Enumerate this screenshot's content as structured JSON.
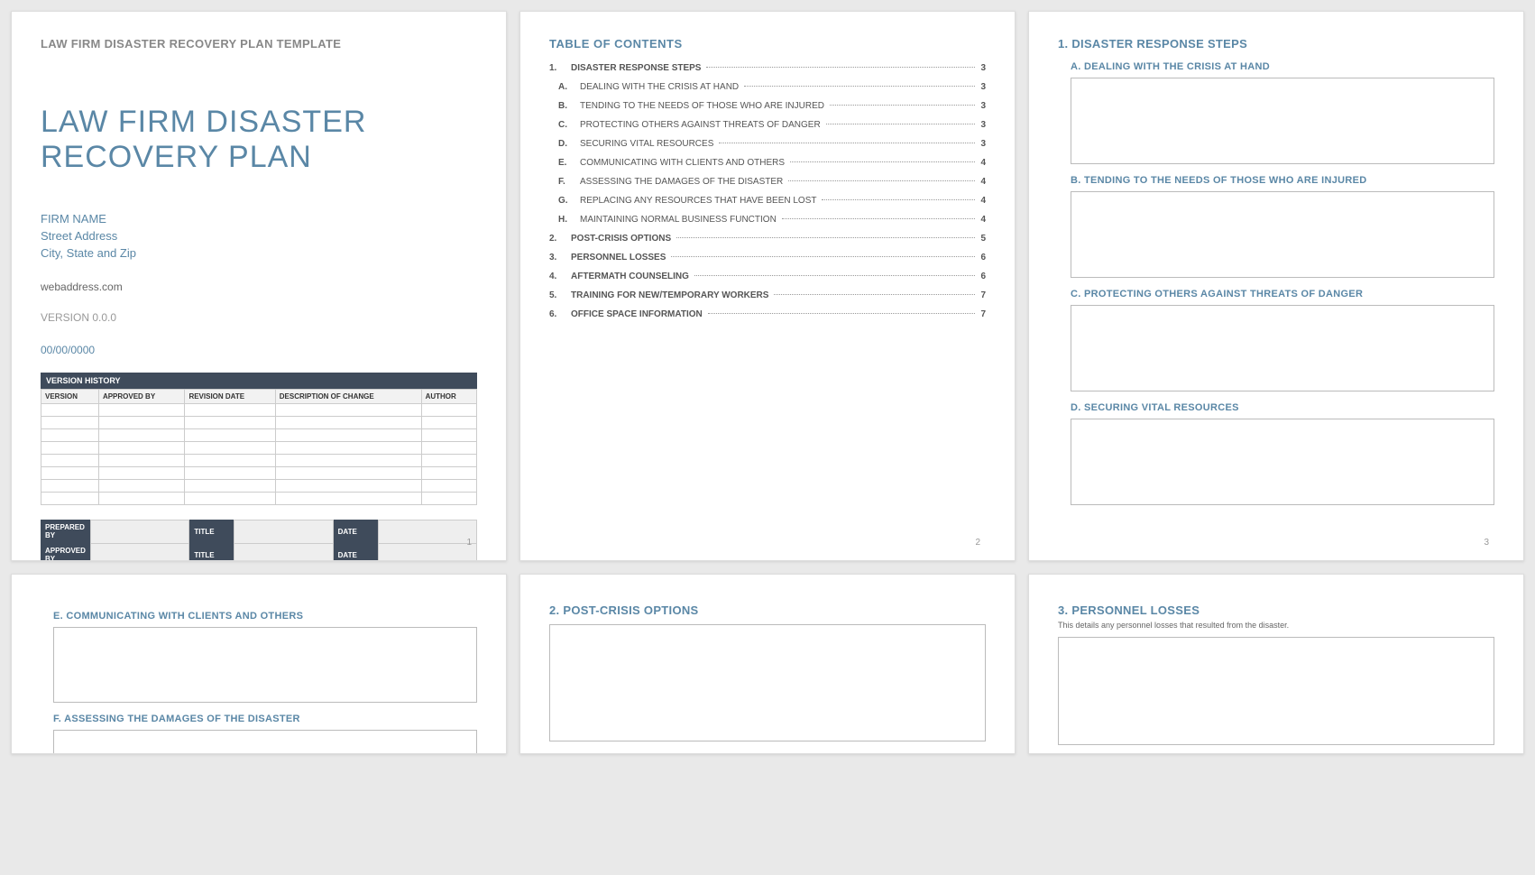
{
  "page1": {
    "template_title": "LAW FIRM DISASTER RECOVERY PLAN TEMPLATE",
    "main_title": "LAW FIRM DISASTER RECOVERY PLAN",
    "firm_name": "FIRM NAME",
    "street": "Street Address",
    "city": "City, State and Zip",
    "web": "webaddress.com",
    "version": "VERSION 0.0.0",
    "date": "00/00/0000",
    "vh_title": "VERSION HISTORY",
    "cols": {
      "c1": "VERSION",
      "c2": "APPROVED BY",
      "c3": "REVISION DATE",
      "c4": "DESCRIPTION OF CHANGE",
      "c5": "AUTHOR"
    },
    "sig": {
      "r1": "PREPARED BY",
      "r2": "APPROVED BY",
      "title": "TITLE",
      "date": "DATE"
    },
    "pnum": "1"
  },
  "page2": {
    "title": "TABLE OF CONTENTS",
    "items": [
      {
        "n": "1.",
        "t": "DISASTER RESPONSE STEPS",
        "p": "3",
        "b": true
      },
      {
        "n": "A.",
        "t": "DEALING WITH THE CRISIS AT HAND",
        "p": "3"
      },
      {
        "n": "B.",
        "t": "TENDING TO THE NEEDS OF THOSE WHO ARE INJURED",
        "p": "3"
      },
      {
        "n": "C.",
        "t": "PROTECTING OTHERS AGAINST THREATS OF DANGER",
        "p": "3"
      },
      {
        "n": "D.",
        "t": "SECURING VITAL RESOURCES",
        "p": "3"
      },
      {
        "n": "E.",
        "t": "COMMUNICATING WITH CLIENTS AND OTHERS",
        "p": "4"
      },
      {
        "n": "F.",
        "t": "ASSESSING THE DAMAGES OF THE DISASTER",
        "p": "4"
      },
      {
        "n": "G.",
        "t": "REPLACING ANY RESOURCES THAT HAVE BEEN LOST",
        "p": "4"
      },
      {
        "n": "H.",
        "t": "MAINTAINING NORMAL BUSINESS FUNCTION",
        "p": "4"
      },
      {
        "n": "2.",
        "t": "POST-CRISIS OPTIONS",
        "p": "5",
        "b": true
      },
      {
        "n": "3.",
        "t": "PERSONNEL LOSSES",
        "p": "6",
        "b": true
      },
      {
        "n": "4.",
        "t": "AFTERMATH COUNSELING",
        "p": "6",
        "b": true
      },
      {
        "n": "5.",
        "t": "TRAINING FOR NEW/TEMPORARY WORKERS",
        "p": "7",
        "b": true
      },
      {
        "n": "6.",
        "t": "OFFICE SPACE INFORMATION",
        "p": "7",
        "b": true
      }
    ],
    "pnum": "2"
  },
  "page3": {
    "title": "1.  DISASTER RESPONSE STEPS",
    "subs": {
      "a": "A.  DEALING WITH THE CRISIS AT HAND",
      "b": "B.  TENDING TO THE NEEDS OF THOSE WHO ARE INJURED",
      "c": "C.  PROTECTING OTHERS AGAINST THREATS OF DANGER",
      "d": "D.  SECURING VITAL RESOURCES"
    },
    "pnum": "3"
  },
  "page4": {
    "e": "E.  COMMUNICATING WITH CLIENTS AND OTHERS",
    "f": "F.  ASSESSING THE DAMAGES OF THE DISASTER"
  },
  "page5": {
    "title": "2.  POST-CRISIS OPTIONS"
  },
  "page6": {
    "title": "3.  PERSONNEL LOSSES",
    "desc": "This details any personnel losses that resulted from the disaster."
  }
}
